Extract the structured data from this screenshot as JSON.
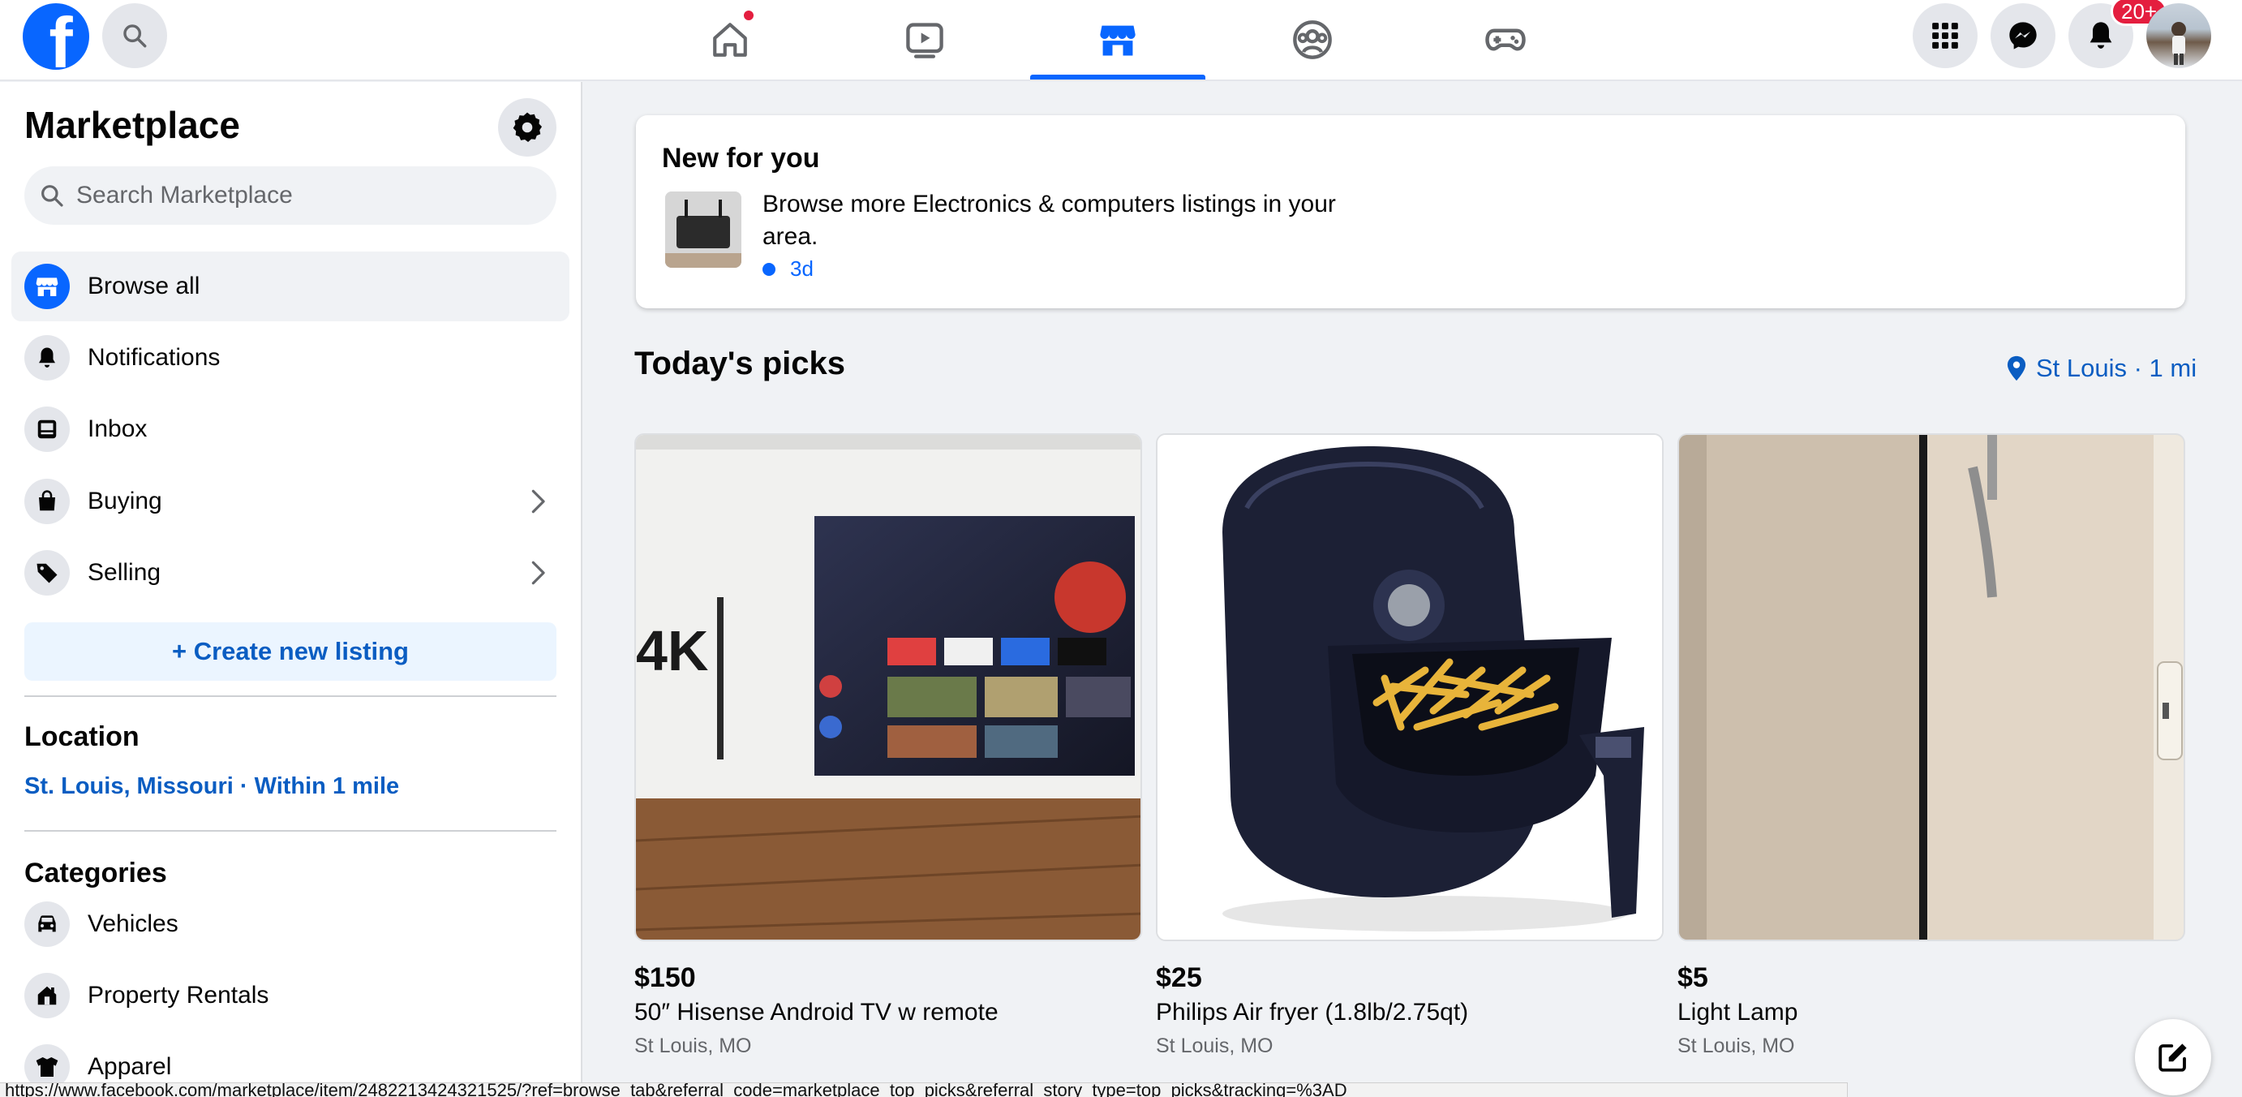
{
  "topbar": {
    "notifications_badge": "20+",
    "nav_tabs": [
      "home",
      "watch",
      "marketplace",
      "groups",
      "gaming"
    ],
    "active_tab": "marketplace"
  },
  "sidebar": {
    "title": "Marketplace",
    "search_placeholder": "Search Marketplace",
    "items": [
      {
        "label": "Browse all",
        "icon": "storefront-icon"
      },
      {
        "label": "Notifications",
        "icon": "bell-icon"
      },
      {
        "label": "Inbox",
        "icon": "inbox-icon"
      },
      {
        "label": "Buying",
        "icon": "shopping-bag-icon"
      },
      {
        "label": "Selling",
        "icon": "price-tag-icon"
      }
    ],
    "create_listing_label": "+ Create new listing",
    "location_title": "Location",
    "location_value": "St. Louis, Missouri · Within 1 mile",
    "categories_title": "Categories",
    "categories": [
      {
        "label": "Vehicles",
        "icon": "car-icon"
      },
      {
        "label": "Property Rentals",
        "icon": "house-icon"
      },
      {
        "label": "Apparel",
        "icon": "shirt-icon"
      }
    ]
  },
  "main": {
    "new_for_you": {
      "title": "New for you",
      "description": "Browse more Electronics & computers listings in your area.",
      "time": "3d"
    },
    "picks_title": "Today's picks",
    "picks_location": "St Louis · 1 mi",
    "listings": [
      {
        "price": "$150",
        "name": "50″ Hisense Android TV w remote",
        "location": "St Louis, MO"
      },
      {
        "price": "$25",
        "name": "Philips Air fryer (1.8lb/2.75qt)",
        "location": "St Louis, MO"
      },
      {
        "price": "$5",
        "name": "Light Lamp",
        "location": "St Louis, MO"
      }
    ]
  },
  "statusbar": {
    "url_text": "https://www.facebook.com/marketplace/item/2482213424321525/?ref=browse_tab&referral_code=marketplace_top_picks&referral_story_type=top_picks&tracking=%3AD"
  },
  "colors": {
    "brand_blue": "#0866ff",
    "link_blue": "#0a5dc2",
    "badge_red": "#e41e3f"
  }
}
